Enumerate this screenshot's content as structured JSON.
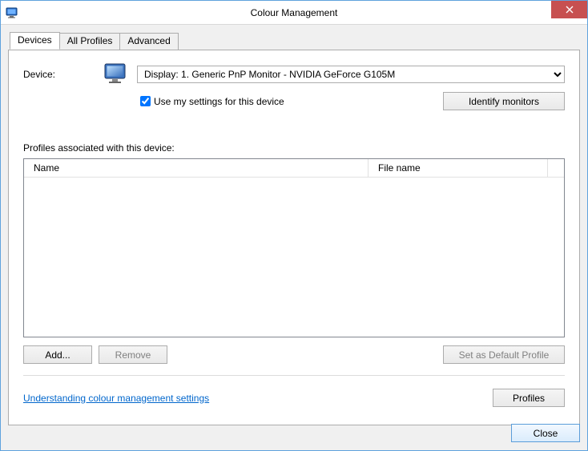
{
  "window": {
    "title": "Colour Management"
  },
  "tabs": {
    "devices": "Devices",
    "profiles": "All Profiles",
    "advanced": "Advanced"
  },
  "device": {
    "label": "Device:",
    "selected": "Display: 1. Generic PnP Monitor - NVIDIA GeForce G105M",
    "use_my_settings_label": "Use my settings for this device",
    "use_my_settings_checked": true,
    "identify_button": "Identify monitors"
  },
  "profiles": {
    "caption": "Profiles associated with this device:",
    "columns": {
      "name": "Name",
      "file": "File name"
    },
    "rows": []
  },
  "buttons": {
    "add": "Add...",
    "remove": "Remove",
    "set_default": "Set as Default Profile",
    "profiles": "Profiles",
    "close": "Close"
  },
  "link": {
    "understanding": "Understanding colour management settings"
  }
}
